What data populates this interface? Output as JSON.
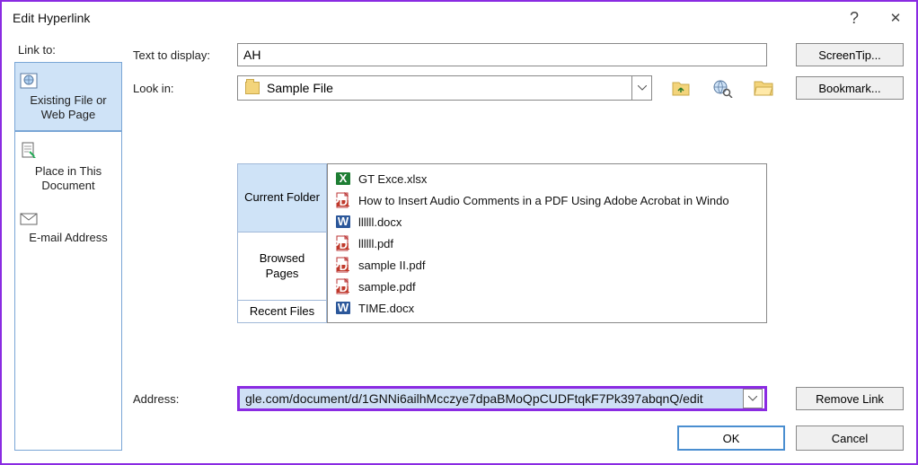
{
  "window": {
    "title": "Edit Hyperlink",
    "help_label": "?",
    "close_label": "✕"
  },
  "sidebar": {
    "heading": "Link to:",
    "items": [
      {
        "label": "Existing File or Web Page",
        "selected": true
      },
      {
        "label": "Place in This Document",
        "selected": false
      },
      {
        "label": "E-mail Address",
        "selected": false
      }
    ]
  },
  "text_to_display": {
    "label": "Text to display:",
    "value": "AH"
  },
  "screentip_btn": "ScreenTip...",
  "look_in": {
    "label": "Look in:",
    "value": "Sample File"
  },
  "toolbar": {
    "up_one_level": "up-one-level",
    "browse_web": "browse-web",
    "browse_file": "browse-file"
  },
  "bookmark_btn": "Bookmark...",
  "tabs": [
    {
      "label": "Current Folder",
      "selected": true
    },
    {
      "label": "Browsed Pages",
      "selected": false
    },
    {
      "label": "Recent Files",
      "selected": false
    }
  ],
  "files": [
    {
      "icon": "excel",
      "name": "GT Exce.xlsx"
    },
    {
      "icon": "pdf",
      "name": "How to Insert Audio Comments in a PDF Using Adobe Acrobat in Windo"
    },
    {
      "icon": "word",
      "name": "llllll.docx"
    },
    {
      "icon": "pdf",
      "name": "llllll.pdf"
    },
    {
      "icon": "pdf",
      "name": "sample II.pdf"
    },
    {
      "icon": "pdf",
      "name": "sample.pdf"
    },
    {
      "icon": "word",
      "name": "TIME.docx"
    }
  ],
  "address": {
    "label": "Address:",
    "value": "gle.com/document/d/1GNNi6ailhMcczye7dpaBMoQpCUDFtqkF7Pk397abqnQ/edit"
  },
  "remove_link_btn": "Remove Link",
  "ok_btn": "OK",
  "cancel_btn": "Cancel"
}
